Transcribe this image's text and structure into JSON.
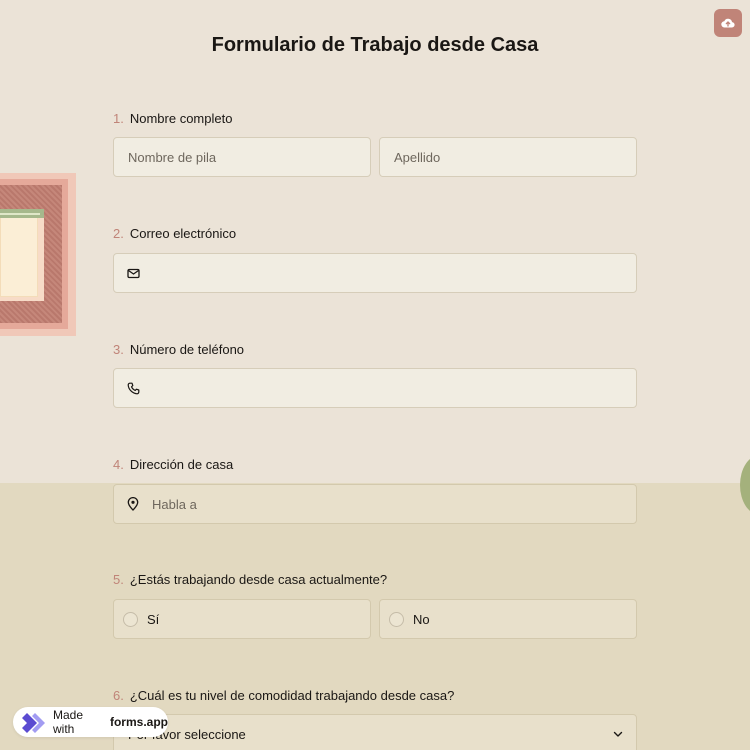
{
  "form": {
    "title": "Formulario de Trabajo desde Casa",
    "questions": [
      {
        "number": "1.",
        "label": "Nombre completo",
        "first_placeholder": "Nombre de pila",
        "last_placeholder": "Apellido"
      },
      {
        "number": "2.",
        "label": "Correo electrónico",
        "icon": "mail-icon",
        "value": ""
      },
      {
        "number": "3.",
        "label": "Número de teléfono",
        "icon": "phone-icon",
        "value": ""
      },
      {
        "number": "4.",
        "label": "Dirección de casa",
        "icon": "map-pin-icon",
        "placeholder": "Habla a"
      },
      {
        "number": "5.",
        "label": "¿Estás trabajando desde casa actualmente?",
        "options": [
          "Sí",
          "No"
        ]
      },
      {
        "number": "6.",
        "label": "¿Cuál es tu nivel de comodidad trabajando desde casa?",
        "select_value": "Por favor seleccione"
      }
    ]
  },
  "toolbar": {
    "upload_icon": "cloud-upload-icon"
  },
  "badge": {
    "prefix": "Made with",
    "brand": "forms.app"
  },
  "colors": {
    "accent": "#c08478",
    "background_top": "#ebe3d7",
    "background_bottom": "#e2d9c0",
    "field": "#f1ede2"
  }
}
